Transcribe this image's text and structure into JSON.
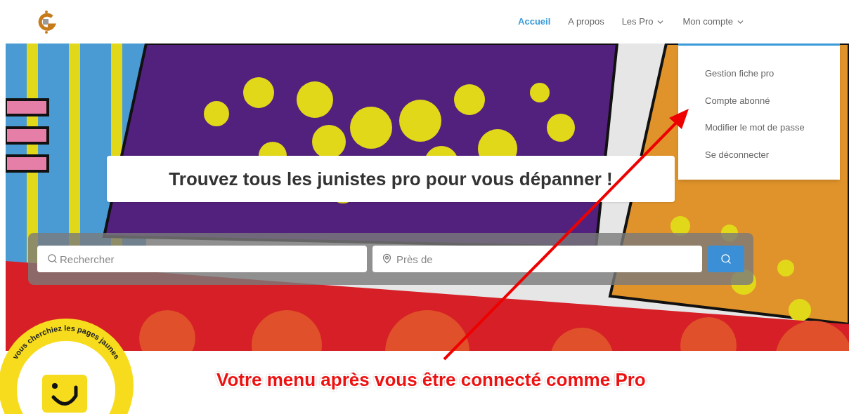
{
  "nav": [
    {
      "label": "Accueil",
      "selected": true,
      "has_caret": false
    },
    {
      "label": "A propos",
      "selected": false,
      "has_caret": false
    },
    {
      "label": "Les Pro",
      "selected": false,
      "has_caret": true
    },
    {
      "label": "Mon compte",
      "selected": false,
      "has_caret": true
    }
  ],
  "account_menu": {
    "open": true,
    "items": [
      "Gestion fiche pro",
      "Compte abonné",
      "Modifier le mot de passe",
      "Se déconnecter"
    ]
  },
  "hero": {
    "title": "Trouvez tous les junistes pro pour vous dépanner !"
  },
  "search": {
    "query_placeholder": "Rechercher",
    "location_placeholder": "Près de"
  },
  "badge": {
    "text": "vous cherchiez les pages jaunes"
  },
  "annotation": {
    "caption": "Votre menu après vous être connecté comme Pro"
  }
}
